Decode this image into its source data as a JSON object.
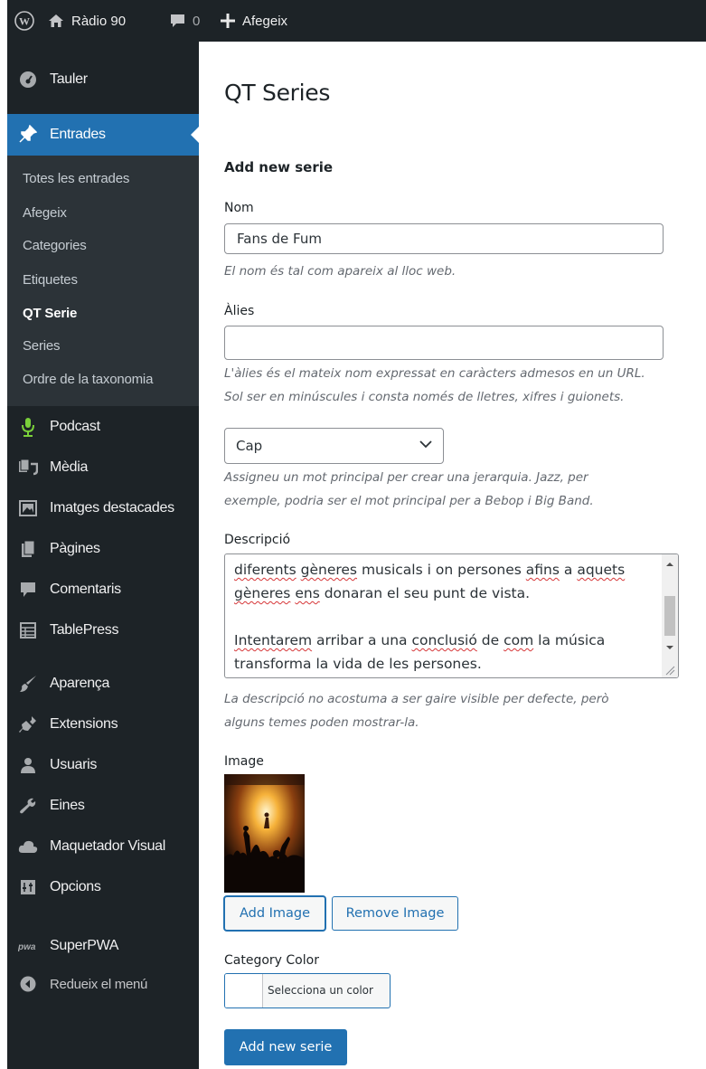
{
  "admin_bar": {
    "site_name": "Ràdio 90",
    "comments_count": "0",
    "new_label": "Afegeix"
  },
  "sidebar": {
    "items": [
      {
        "label": "Tauler",
        "icon": "dashboard-icon"
      },
      {
        "label": "Entrades",
        "icon": "pin-icon"
      },
      {
        "label": "Podcast",
        "icon": "microphone-icon"
      },
      {
        "label": "Mèdia",
        "icon": "media-icon"
      },
      {
        "label": "Imatges destacades",
        "icon": "images-icon"
      },
      {
        "label": "Pàgines",
        "icon": "pages-icon"
      },
      {
        "label": "Comentaris",
        "icon": "comment-icon"
      },
      {
        "label": "TablePress",
        "icon": "table-icon"
      },
      {
        "label": "Aparença",
        "icon": "brush-icon"
      },
      {
        "label": "Extensions",
        "icon": "plugin-icon"
      },
      {
        "label": "Usuaris",
        "icon": "users-icon"
      },
      {
        "label": "Eines",
        "icon": "wrench-icon"
      },
      {
        "label": "Maquetador Visual",
        "icon": "cloud-icon"
      },
      {
        "label": "Opcions",
        "icon": "settings-icon"
      },
      {
        "label": "SuperPWA",
        "icon": "pwa-icon"
      }
    ],
    "submenu": [
      "Totes les entrades",
      "Afegeix",
      "Categories",
      "Etiquetes",
      "QT Serie",
      "Series",
      "Ordre de la taxonomia"
    ],
    "collapse_label": "Redueix el menú"
  },
  "main": {
    "title": "QT Series",
    "section_heading": "Add new serie",
    "name_label": "Nom",
    "name_value": "Fans de Fum",
    "name_hint": "El nom és tal com apareix al lloc web.",
    "slug_label": "Àlies",
    "slug_value": "",
    "slug_hint_line1": "L'àlies és el mateix nom expressat en caràcters admesos en un URL.",
    "slug_hint_line2": "Sol ser en minúscules i consta només de lletres, xifres i guionets.",
    "parent_value": "Cap",
    "parent_hint_line1": "Assigneu un mot principal per crear una jerarquia. Jazz, per",
    "parent_hint_line2": "exemple, podria ser el mot principal per a Bebop i Big Band.",
    "description_label": "Descripció",
    "description_line1": "diferents gèneres musicals i on persones afins a aquets",
    "description_line2": "gèneres ens donaran el seu punt de vista.",
    "description_line3": "Intentarem arribar a una conclusió de com la música",
    "description_line4": "transforma la vida de les persones.",
    "description_hint_line1": "La descripció no acostuma a ser gaire visible per defecte, però",
    "description_hint_line2": "alguns temes poden mostrar-la.",
    "image_label": "Image",
    "add_image_label": "Add Image",
    "remove_image_label": "Remove Image",
    "color_label": "Category Color",
    "color_button_label": "Selecciona un color",
    "submit_label": "Add new serie"
  },
  "colors": {
    "admin_bar_bg": "#1d2327",
    "sidebar_bg": "#1d2327",
    "submenu_bg": "#2c3338",
    "accent": "#2271b1"
  }
}
